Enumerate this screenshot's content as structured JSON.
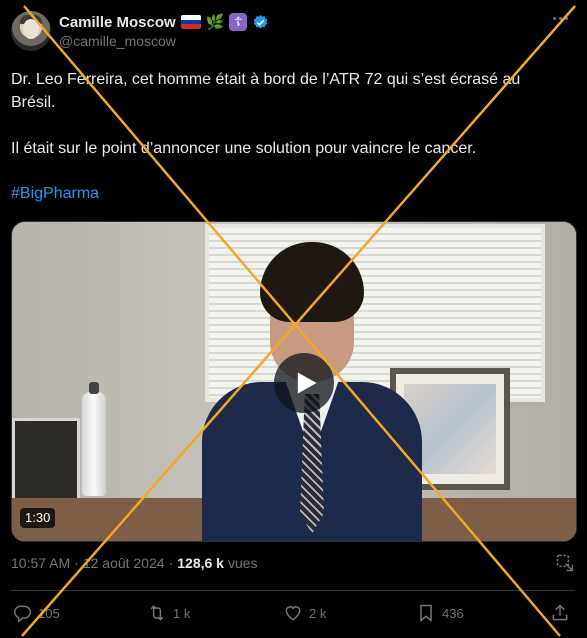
{
  "author": {
    "name": "Camille Moscow",
    "handle": "@camille_moscow",
    "badges": [
      "russia-flag-icon",
      "olive-branch-icon",
      "orthodox-cross-icon",
      "verified-icon"
    ],
    "orthodox_cross_glyph": "☦",
    "olive_glyph": "🌿"
  },
  "tweet": {
    "text_line1": "Dr. Leo Ferreira, cet homme était à bord de l’ATR 72 qui s’est écrasé au Brésil.",
    "text_line2": "Il était sur le point d’annoncer une solution pour vaincre le cancer.",
    "hashtag": "#BigPharma"
  },
  "video": {
    "duration": "1:30"
  },
  "meta": {
    "time": "10:57 AM",
    "separator1": "·",
    "date": "12 août 2024",
    "separator2": "·",
    "views_count": "128,6 k",
    "views_label": "vues"
  },
  "actions": {
    "replies": "105",
    "retweets": "1 k",
    "likes": "2 k",
    "bookmarks": "436"
  },
  "colors": {
    "background": "#000000",
    "text": "#e7e9ea",
    "muted": "#71767b",
    "link": "#1d9bf0",
    "overlay_x": "#f5a623"
  }
}
